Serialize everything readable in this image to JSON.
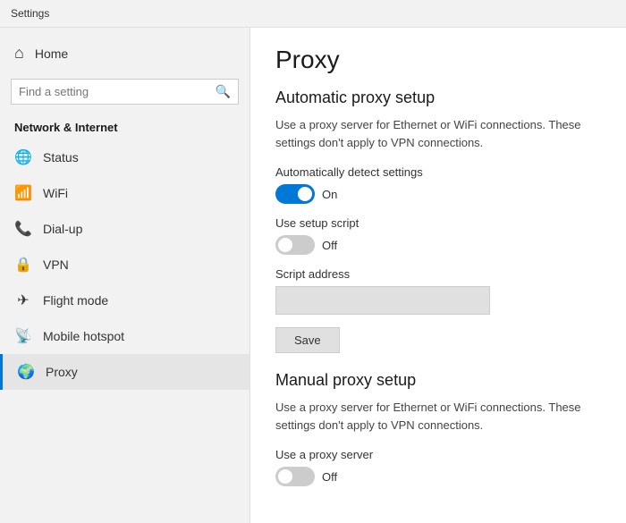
{
  "titleBar": {
    "label": "Settings"
  },
  "sidebar": {
    "searchPlaceholder": "Find a setting",
    "sectionTitle": "Network & Internet",
    "homeLabel": "Home",
    "items": [
      {
        "id": "status",
        "label": "Status",
        "icon": "🌐"
      },
      {
        "id": "wifi",
        "label": "WiFi",
        "icon": "📶"
      },
      {
        "id": "dialup",
        "label": "Dial-up",
        "icon": "📞"
      },
      {
        "id": "vpn",
        "label": "VPN",
        "icon": "🔒"
      },
      {
        "id": "flightmode",
        "label": "Flight mode",
        "icon": "✈"
      },
      {
        "id": "mobilehotspot",
        "label": "Mobile hotspot",
        "icon": "📡"
      },
      {
        "id": "proxy",
        "label": "Proxy",
        "icon": "🌍",
        "active": true
      }
    ]
  },
  "main": {
    "pageTitle": "Proxy",
    "automaticSection": {
      "title": "Automatic proxy setup",
      "description": "Use a proxy server for Ethernet or WiFi connections. These settings don't apply to VPN connections.",
      "autoDetectLabel": "Automatically detect settings",
      "autoDetectState": "on",
      "autoDetectText": "On",
      "setupScriptLabel": "Use setup script",
      "setupScriptState": "off",
      "setupScriptText": "Off",
      "scriptAddressLabel": "Script address",
      "scriptAddressPlaceholder": "",
      "saveButton": "Save"
    },
    "manualSection": {
      "title": "Manual proxy setup",
      "description": "Use a proxy server for Ethernet or WiFi connections. These settings don't apply to VPN connections.",
      "useProxyLabel": "Use a proxy server",
      "useProxyState": "off",
      "useProxyText": "Off"
    }
  }
}
